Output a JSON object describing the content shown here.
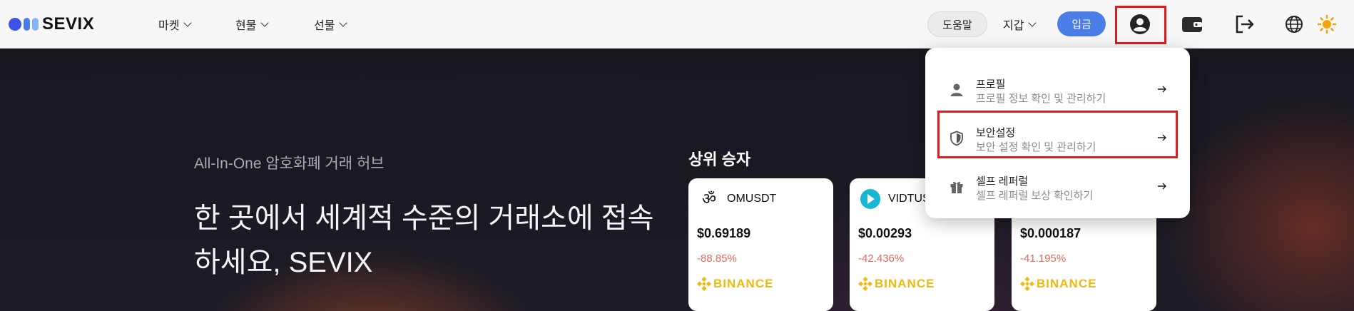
{
  "header": {
    "logo_text": "SEVIX",
    "nav": [
      {
        "label": "마켓"
      },
      {
        "label": "현물"
      },
      {
        "label": "선물"
      }
    ],
    "help_label": "도움말",
    "wallet_label": "지갑",
    "deposit_label": "입금",
    "icons": [
      "profile-icon",
      "wallet-icon",
      "logout-icon",
      "globe-icon",
      "sun-icon"
    ],
    "accent_color": "#4a7ee6"
  },
  "hero": {
    "subtitle": "All-In-One 암호화폐 거래 허브",
    "headline": "한 곳에서 세계적 수준의 거래소에 접속하세요, SEVIX",
    "gainers_title": "상위 승자",
    "cards": [
      {
        "symbol": "OMUSDT",
        "icon": "om-icon",
        "price": "$0.69189",
        "change": "-88.85%",
        "exchange": "BINANCE"
      },
      {
        "symbol": "VIDTUS",
        "icon": "vidt-icon",
        "price": "$0.00293",
        "change": "-42.436%",
        "exchange": "BINANCE"
      },
      {
        "symbol": "",
        "icon": "",
        "price": "$0.000187",
        "change": "-41.195%",
        "exchange": "BINANCE"
      }
    ],
    "negative_color": "#e7685f",
    "binance_color": "#f0b90b"
  },
  "dropdown": {
    "items": [
      {
        "title": "프로필",
        "desc": "프로필 정보 확인 및 관리하기",
        "icon": "person-icon"
      },
      {
        "title": "보안설정",
        "desc": "보안 설정 확인 및 관리하기",
        "icon": "shield-icon"
      },
      {
        "title": "셀프 레퍼럴",
        "desc": "셀프 레퍼럴 보상 확인하기",
        "icon": "gift-icon"
      }
    ]
  }
}
